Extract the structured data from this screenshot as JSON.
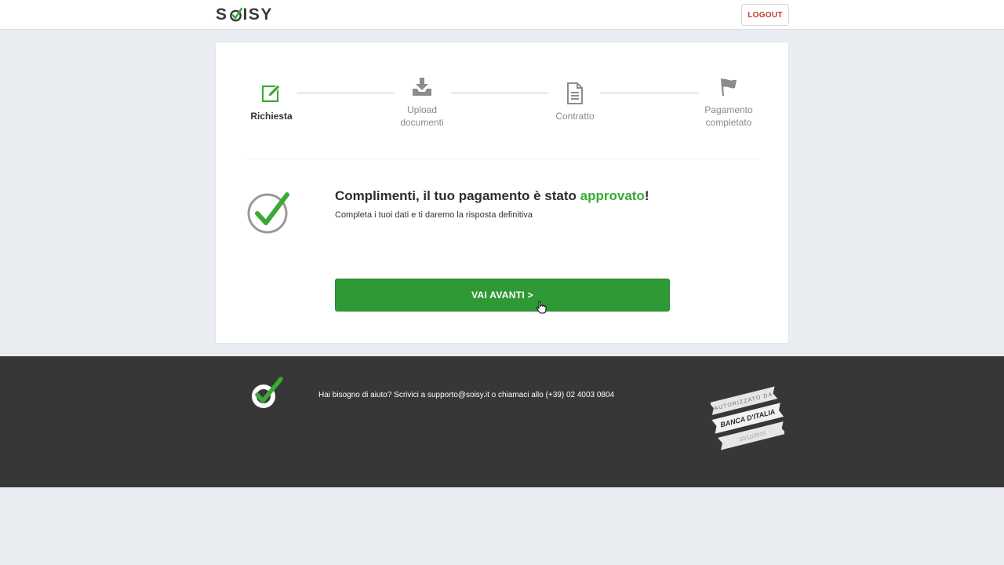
{
  "header": {
    "logo_text": "SOISY",
    "logout_label": "LOGOUT"
  },
  "steps": [
    {
      "label": "Richiesta",
      "icon": "edit-icon",
      "state": "active"
    },
    {
      "label": "Upload\ndocumenti",
      "icon": "download-tray-icon",
      "state": "inactive"
    },
    {
      "label": "Contratto",
      "icon": "document-icon",
      "state": "inactive"
    },
    {
      "label": "Pagamento\ncompletato",
      "icon": "flag-icon",
      "state": "inactive"
    }
  ],
  "result": {
    "headline_prefix": "Complimenti, il tuo pagamento è stato ",
    "headline_highlight": "approvato",
    "headline_suffix": "!",
    "subline": "Completa i tuoi dati e ti daremo la risposta definitiva",
    "cta_label": "VAI AVANTI >"
  },
  "footer": {
    "help_text": "Hai bisogno di aiuto? Scrivici a supporto@soisy.it o chiamaci allo (+39) 02 4003 0804",
    "badge_top": "AUTORIZZATO DA",
    "badge_middle": "BANCA D'ITALIA",
    "badge_bottom": "10/11/2015"
  },
  "colors": {
    "accent_green": "#3aa935",
    "button_green": "#2f9a35",
    "logout_red": "#c0392b",
    "footer_bg": "#373737",
    "page_bg": "#e9ecf0"
  }
}
